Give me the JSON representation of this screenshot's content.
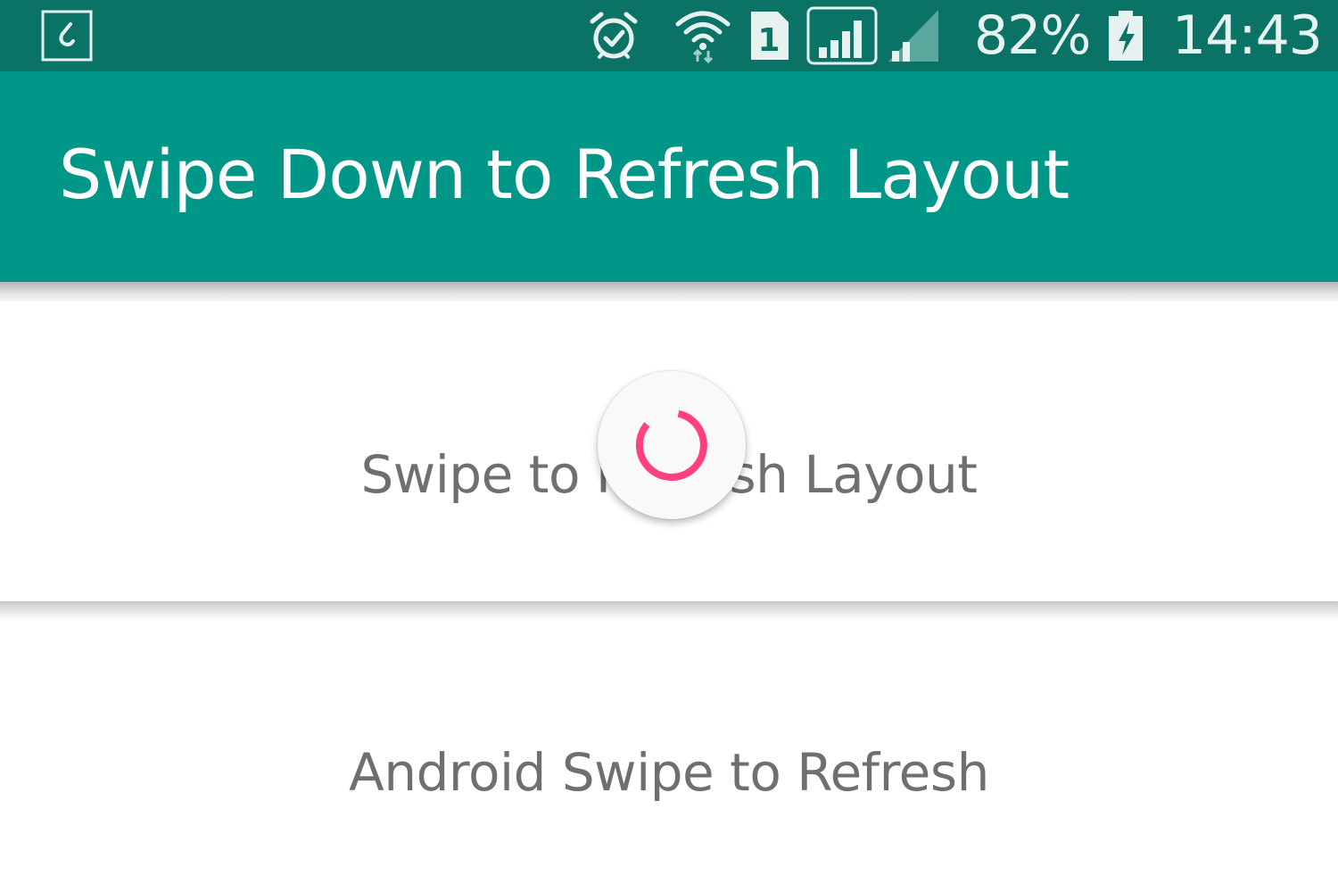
{
  "status_bar": {
    "battery_percent": "82%",
    "time": "14:43",
    "sim_label": "1",
    "icons": [
      "notification-icon",
      "alarm-icon",
      "wifi-icon",
      "sim-1-icon",
      "signal-icon",
      "signal-secondary-icon",
      "battery-charging-icon"
    ]
  },
  "app_bar": {
    "title": "Swipe Down to Refresh Layout"
  },
  "list": {
    "items": [
      {
        "label": "Swipe to Refresh Layout"
      },
      {
        "label": "Android Swipe to Refresh"
      }
    ]
  },
  "refresh_indicator": {
    "icon": "refresh-spinner-icon",
    "color": "#ff4081"
  },
  "colors": {
    "status_bar": "#0b7366",
    "app_bar": "#009688",
    "accent": "#ff4081",
    "item_text": "#6f6f6f"
  }
}
